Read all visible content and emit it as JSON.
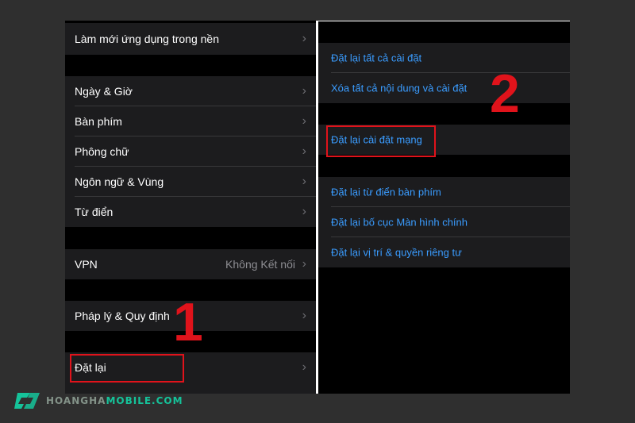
{
  "left_menu": {
    "top_item": "Làm mới ứng dụng trong nền",
    "group1": [
      "Ngày & Giờ",
      "Bàn phím",
      "Phông chữ",
      "Ngôn ngữ & Vùng",
      "Từ điển"
    ],
    "vpn": {
      "label": "VPN",
      "value": "Không Kết nối"
    },
    "legal": "Pháp lý & Quy định",
    "reset": "Đặt lại"
  },
  "right_menu": {
    "group1": [
      "Đặt lại tất cả cài đặt",
      "Xóa tất cả nội dung và cài đặt"
    ],
    "network": "Đặt lại cài đặt mạng",
    "group2": [
      "Đặt lại từ điển bàn phím",
      "Đặt lại bố cục Màn hình chính",
      "Đặt lại vị trí & quyền riêng tư"
    ]
  },
  "steps": {
    "one": "1",
    "two": "2"
  },
  "brand": {
    "part1": "HOANGHA",
    "part2": "MOBILE.COM"
  },
  "icons": {
    "chevron": "chevron-right-icon",
    "logo": "hoangha-logo-icon"
  },
  "colors": {
    "highlight": "#e0131b",
    "link": "#3a9cff",
    "brand": "#15c39a"
  }
}
